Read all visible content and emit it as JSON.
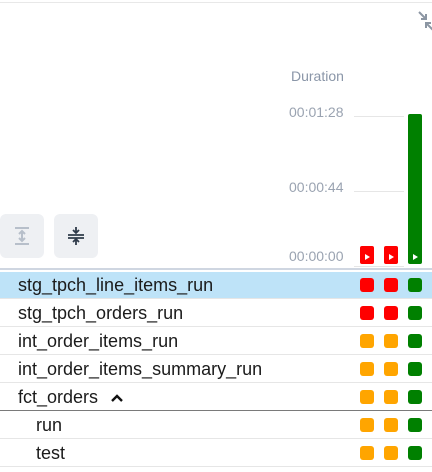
{
  "header": {
    "duration_label": "Duration"
  },
  "axis": {
    "ticks": [
      "00:01:28",
      "00:00:44",
      "00:00:00"
    ]
  },
  "controls": [
    {
      "name": "expand-all-button",
      "icon": "expand-vertical-icon"
    },
    {
      "name": "collapse-all-button",
      "icon": "collapse-vertical-icon"
    }
  ],
  "colors": {
    "success": "#008000",
    "failed": "#ff0000",
    "upstream_failed": "#ffa500",
    "selected_row": "#bee3f8"
  },
  "runs": [
    {
      "state": "failed",
      "duration_fraction": 0.11
    },
    {
      "state": "failed",
      "duration_fraction": 0.11
    },
    {
      "state": "success",
      "duration_fraction": 1.0
    }
  ],
  "tasks": [
    {
      "label": "stg_tpch_line_items_run",
      "states": [
        "failed",
        "failed",
        "success"
      ],
      "selected": true
    },
    {
      "label": "stg_tpch_orders_run",
      "states": [
        "failed",
        "failed",
        "success"
      ]
    },
    {
      "label": "int_order_items_run",
      "states": [
        "upstream_failed",
        "upstream_failed",
        "success"
      ]
    },
    {
      "label": "int_order_items_summary_run",
      "states": [
        "upstream_failed",
        "upstream_failed",
        "success"
      ]
    },
    {
      "label": "fct_orders",
      "states": [
        "upstream_failed",
        "upstream_failed",
        "success"
      ],
      "group": true,
      "expanded": true
    },
    {
      "label": "run",
      "states": [
        "upstream_failed",
        "upstream_failed",
        "success"
      ],
      "child": true
    },
    {
      "label": "test",
      "states": [
        "upstream_failed",
        "upstream_failed",
        "success"
      ],
      "child": true
    }
  ]
}
